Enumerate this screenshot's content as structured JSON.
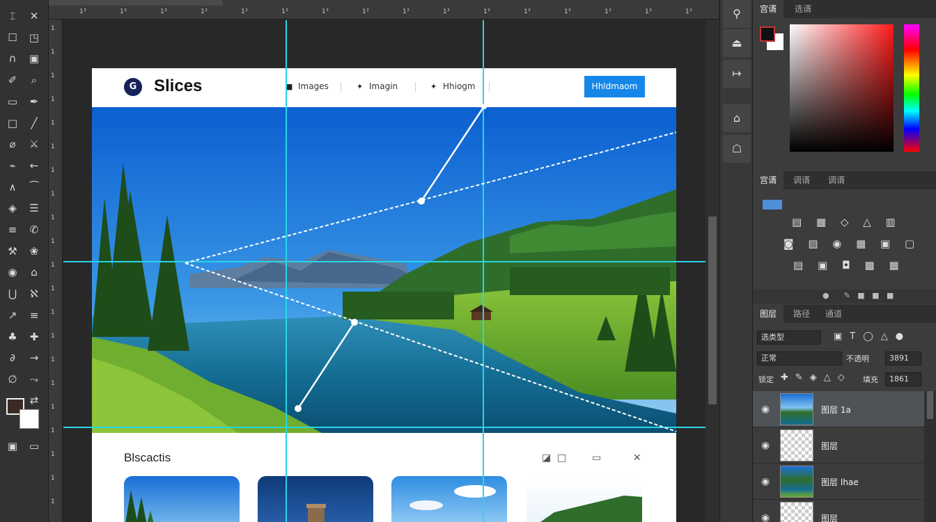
{
  "ruler_top": {
    "numbers": [
      "1²",
      "1²",
      "1²",
      "1²",
      "1²",
      "1²",
      "1²",
      "1²",
      "1²",
      "1²",
      "1²",
      "1²",
      "1²",
      "1²",
      "1²",
      "1²"
    ]
  },
  "ruler_left": {
    "numbers": [
      "1",
      "1",
      "1",
      "1",
      "1",
      "1",
      "1",
      "1",
      "1",
      "1",
      "1",
      "1",
      "1",
      "1",
      "1",
      "1",
      "1",
      "1",
      "1",
      "1",
      "1"
    ]
  },
  "toolbar": {
    "tools": [
      "⌶",
      "✕",
      "☐",
      "◳",
      "∩",
      "▣",
      "✐",
      "⌕",
      "▭",
      "✒",
      "□",
      "╱",
      "⌀",
      "⚔",
      "⌁",
      "←",
      "∧",
      "⁀",
      "◈",
      "☰",
      "≡",
      "✆",
      "⚒",
      "❀",
      "◉",
      "⌂",
      "⋃",
      "ℵ",
      "↗",
      "≡",
      "♣",
      "✚",
      "∂",
      "→",
      "∅",
      "⤳"
    ],
    "bottom": [
      "▣",
      "▭"
    ],
    "swap": "⇄"
  },
  "document": {
    "logo_mark": "G",
    "logo_text": "Slices",
    "nav": [
      {
        "icon": "■",
        "label": "Images"
      },
      {
        "icon": "✦",
        "label": "Imagin"
      },
      {
        "icon": "✦",
        "label": "Hhiogm"
      }
    ],
    "cta_label": "Hhldmaom",
    "section_title": "Blscactis",
    "section_icons": [
      "◪",
      "□",
      "▭",
      "✕"
    ]
  },
  "dock": {
    "buttons": [
      "⚲",
      "⏏",
      "↦",
      "⌂",
      "☖"
    ]
  },
  "panels": {
    "color_tabs": [
      "宫谞",
      "选谞"
    ],
    "adjust_tabs": [
      "宫谞",
      "调谞",
      "调谞"
    ],
    "adjust_rows": [
      "▤ ▦ ◇ △ ▥",
      "◙ ▨ ◉ ▦ ▣ ▢",
      "▤ ▣ ◘ ▩ ▦"
    ],
    "layers_tabs": [
      "图层",
      "路径",
      "通道"
    ],
    "layers_filter": "选类型",
    "blend_mode": "正常",
    "opacity_label": "不透明",
    "opacity_value": "3891",
    "fill_label": "填充",
    "fill_value": "1861",
    "lock_label": "锁定",
    "layers": [
      {
        "name": "图层 1a",
        "thumb": "landscape",
        "selected": true
      },
      {
        "name": "图层",
        "thumb": "transparent",
        "selected": false
      },
      {
        "name": "图层 Ihae",
        "thumb": "landscape",
        "selected": false
      },
      {
        "name": "图层",
        "thumb": "transparent",
        "selected": false
      }
    ]
  }
}
